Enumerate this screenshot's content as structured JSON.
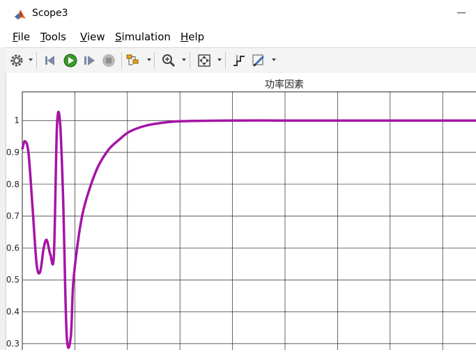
{
  "window": {
    "title": "Scope3"
  },
  "menu": {
    "items": [
      {
        "id": "file",
        "first": "F",
        "rest": "ile"
      },
      {
        "id": "tools",
        "first": "T",
        "rest": "ools"
      },
      {
        "id": "view",
        "first": "V",
        "rest": "iew"
      },
      {
        "id": "simulation",
        "first": "S",
        "rest": "imulation"
      },
      {
        "id": "help",
        "first": "H",
        "rest": "elp"
      }
    ]
  },
  "toolbar": {
    "icons": [
      "gear-icon",
      "step-back-icon",
      "run-icon",
      "step-forward-icon",
      "stop-icon",
      "highlight-block-icon",
      "zoom-icon",
      "fit-to-view-icon",
      "cursor-measure-icon",
      "edit-measure-icon"
    ]
  },
  "colors": {
    "line": "#a614a6",
    "grid": "#262626"
  },
  "chart_data": {
    "type": "line",
    "title": "功率因素",
    "xlabel": "",
    "ylabel": "",
    "grid": true,
    "ylim": [
      0.28,
      1.09
    ],
    "xlim": [
      0,
      8.9
    ],
    "y_ticks": [
      "0.3",
      "0.4",
      "0.5",
      "0.6",
      "0.7",
      "0.8",
      "0.9",
      "1"
    ],
    "series": [
      {
        "values_x": [
          0,
          0.05,
          0.12,
          0.2,
          0.28,
          0.35,
          0.42,
          0.48,
          0.55,
          0.62,
          0.68,
          0.74,
          0.8,
          0.87,
          0.95,
          1.0,
          1.1,
          1.2,
          1.35,
          1.5,
          1.7,
          1.9,
          2.1,
          2.4,
          2.7,
          3.0,
          3.4,
          4.0,
          5.0,
          6.0,
          7.0,
          8.0,
          8.9
        ],
        "values_y": [
          0.91,
          0.935,
          0.9,
          0.73,
          0.55,
          0.525,
          0.6,
          0.625,
          0.58,
          0.58,
          0.98,
          0.995,
          0.76,
          0.33,
          0.32,
          0.49,
          0.63,
          0.72,
          0.8,
          0.86,
          0.91,
          0.94,
          0.965,
          0.983,
          0.992,
          0.997,
          0.999,
          1.0,
          1.0,
          1.0,
          1.0,
          1.0,
          1.0
        ]
      }
    ]
  }
}
